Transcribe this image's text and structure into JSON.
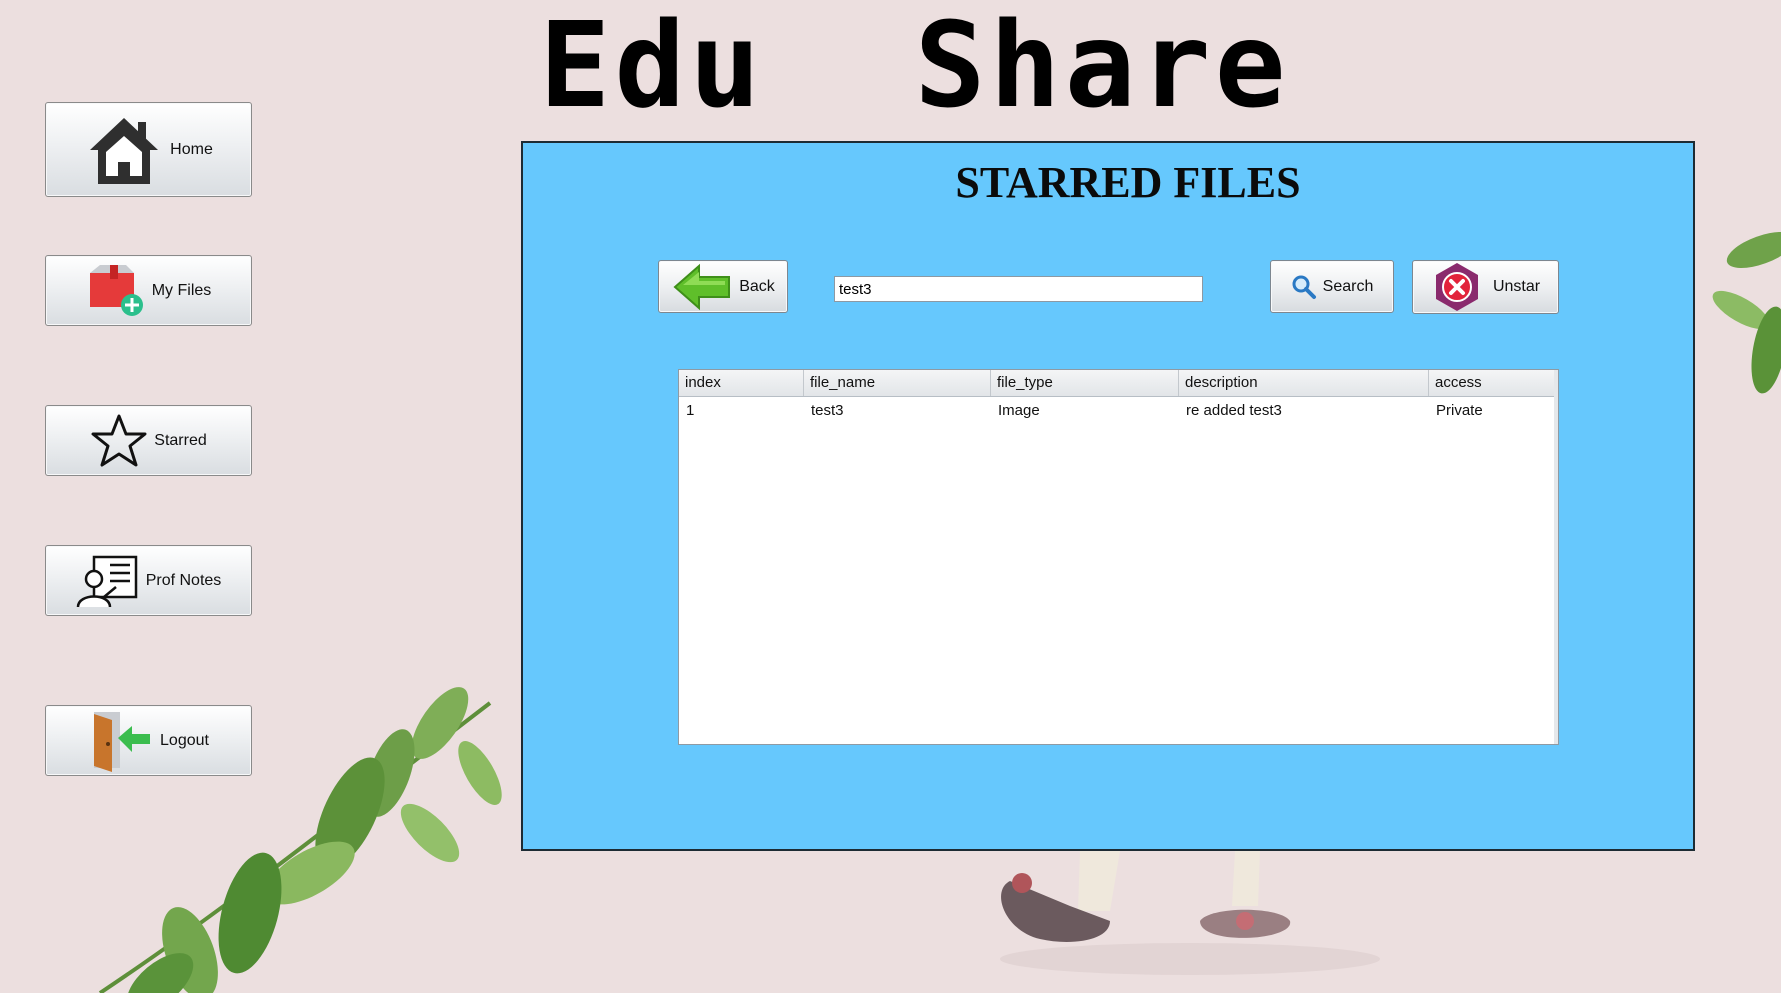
{
  "app": {
    "title": "Edu  Share"
  },
  "sidebar": {
    "items": [
      {
        "label": "Home",
        "icon": "home-icon"
      },
      {
        "label": "My Files",
        "icon": "folder-add-icon"
      },
      {
        "label": "Starred",
        "icon": "star-icon"
      },
      {
        "label": "Prof Notes",
        "icon": "teacher-notes-icon"
      },
      {
        "label": "Logout",
        "icon": "door-exit-icon"
      }
    ]
  },
  "panel": {
    "title": "STARRED FILES",
    "back_label": "Back",
    "search_value": "test3",
    "search_label": "Search",
    "unstar_label": "Unstar",
    "table": {
      "columns": [
        "index",
        "file_name",
        "file_type",
        "description",
        "access"
      ],
      "rows": [
        [
          "1",
          "test3",
          "Image",
          "re added test3",
          "Private"
        ]
      ]
    }
  },
  "colors": {
    "panel_bg": "#66c8fd",
    "page_bg": "#ecdfdf"
  }
}
